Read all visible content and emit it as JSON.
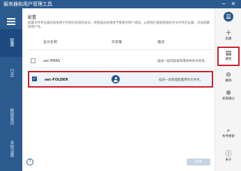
{
  "window": {
    "title": "服务器和用户管理工具",
    "minimize_glyph": "−",
    "close_glyph": "✕"
  },
  "nav": {
    "items": [
      {
        "label": "配置"
      },
      {
        "label": "日志"
      },
      {
        "label": "数据备份"
      },
      {
        "label": "系统设置"
      }
    ]
  },
  "main": {
    "section_title": "配置",
    "description": "配置文件夹设置的权限用于控制对资源的访问，将管理员权限授予需要的用户或组，以便他们能够管理共享文件夹的设置、添加或删除用户等。"
  },
  "table": {
    "headers": {
      "name": "显示名称",
      "admin": "共享権",
      "desc": "描述"
    },
    "rows": [
      {
        "name": "sec-EMAS",
        "desc": "描述一段内容发布用的共享文件夹。",
        "checked": false,
        "check_glyph": ""
      },
      {
        "name": "sec-FOLDER",
        "desc": "描述一段管理配置用的文件夹。",
        "checked": true,
        "check_glyph": "✓"
      }
    ]
  },
  "footer": {
    "help_glyph": "?",
    "apply_label": "应用"
  },
  "actions": [
    {
      "icon": "new-icon",
      "glyph": "＋",
      "label": "新建"
    },
    {
      "icon": "properties-icon",
      "glyph": "▤",
      "label": "属性"
    },
    {
      "icon": "delete-icon",
      "glyph": "⊖",
      "label": "删除"
    },
    {
      "icon": "permissions-icon",
      "glyph": "⊕",
      "label": "权限确认"
    },
    {
      "icon": "search-icon",
      "glyph": "⌕",
      "label": "条件搜索"
    },
    {
      "icon": "info-icon",
      "glyph": "ⓘ",
      "label": "关于"
    }
  ],
  "colors": {
    "primary": "#2b5a8f",
    "highlight": "#cc1f2a",
    "selected_row": "#eef3f9"
  }
}
